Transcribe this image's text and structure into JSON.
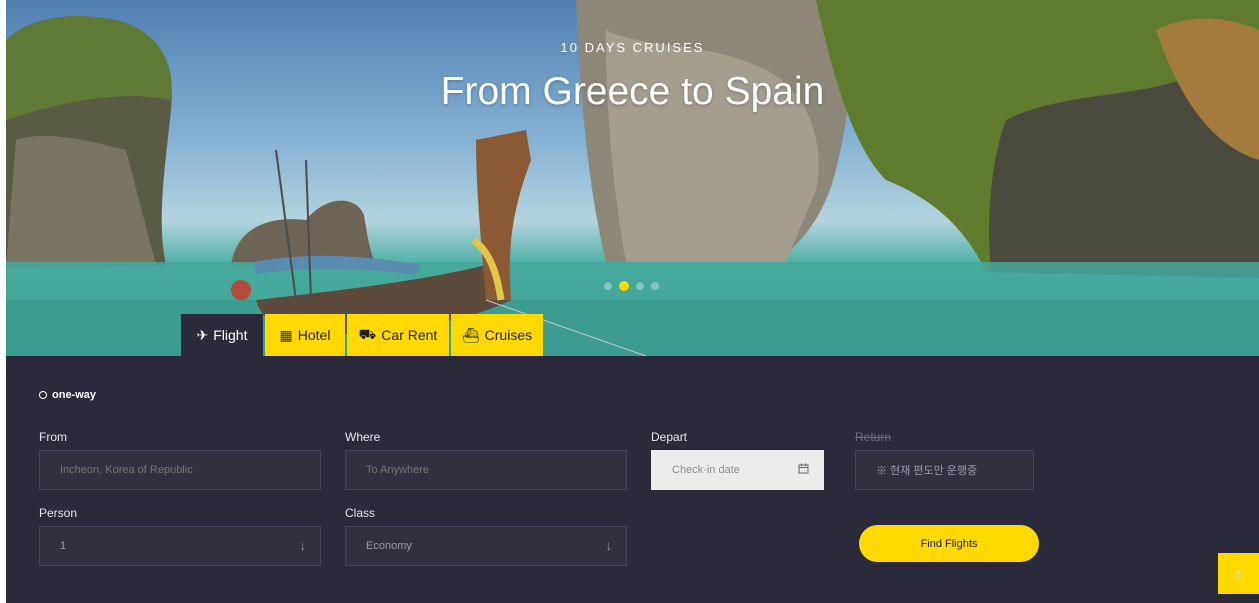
{
  "hero": {
    "subtitle": "10 DAYS CRUISES",
    "title": "From Greece to Spain",
    "slides": 4,
    "active_slide": 2
  },
  "tabs": [
    {
      "label": "Flight",
      "icon": "airplane-icon",
      "glyph": "✈",
      "active": true
    },
    {
      "label": "Hotel",
      "icon": "hotel-icon",
      "glyph": "▦",
      "active": false
    },
    {
      "label": "Car Rent",
      "icon": "car-icon",
      "glyph": "⛟",
      "active": false
    },
    {
      "label": "Cruises",
      "icon": "ship-icon",
      "glyph": "⛴",
      "active": false
    }
  ],
  "form": {
    "trip_type": "one-way",
    "from": {
      "label": "From",
      "placeholder": "Incheon, Korea of Republic"
    },
    "where": {
      "label": "Where",
      "placeholder": "To Anywhere"
    },
    "depart": {
      "label": "Depart",
      "placeholder": "Check-in date"
    },
    "return": {
      "label": "Return",
      "notice": "※ 현재 편도만 운행중"
    },
    "person": {
      "label": "Person",
      "value": "1"
    },
    "class": {
      "label": "Class",
      "value": "Economy"
    },
    "submit_label": "Find Flights"
  },
  "scroll_top_glyph": "↑",
  "colors": {
    "accent": "#ffd900",
    "panel": "#2a2a3b",
    "field": "#30303f"
  }
}
